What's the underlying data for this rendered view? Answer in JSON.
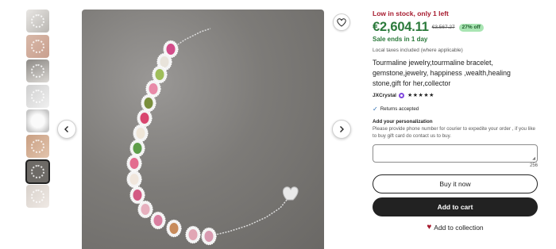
{
  "gallery": {
    "thumbnail_count": 8,
    "selected_index": 6
  },
  "listing": {
    "stock_notice": "Low in stock, only 1 left",
    "price": "€2,604.11",
    "original_price": "€3,567.27",
    "discount": "27% off",
    "sale_ends": "Sale ends in 1 day",
    "taxes_note": "Local taxes included (where applicable)",
    "title": "Tourmaline jewelry,tourmaline bracelet, gemstone,jewelry, happiness ,wealth,healing stone,gift for her,collector",
    "shop_name": "JXCrystal",
    "rating_stars": "★★★★★",
    "returns": "Returns accepted",
    "personalization_label": "Add your personalization",
    "personalization_help": "Please provide phone number for courier to expedite your order , if you like to buy gift card do contact us to buy.",
    "char_counter": "256",
    "buy_now": "Buy it now",
    "add_to_cart": "Add to cart",
    "add_to_collection": "Add to collection"
  },
  "icons": {
    "prev": "chevron-left-icon",
    "next": "chevron-right-icon",
    "favorite": "heart-outline-icon",
    "collection": "heart-filled-icon",
    "check": "check-icon",
    "shop_badge": "star-seller-badge-icon"
  },
  "colors": {
    "stock_red": "#a61a2e",
    "price_green": "#2b7a3b",
    "discount_badge": "#a9e5b3",
    "dark_button": "#222222",
    "check_blue": "#2b6cb0",
    "shop_badge_purple": "#7f47dd"
  }
}
